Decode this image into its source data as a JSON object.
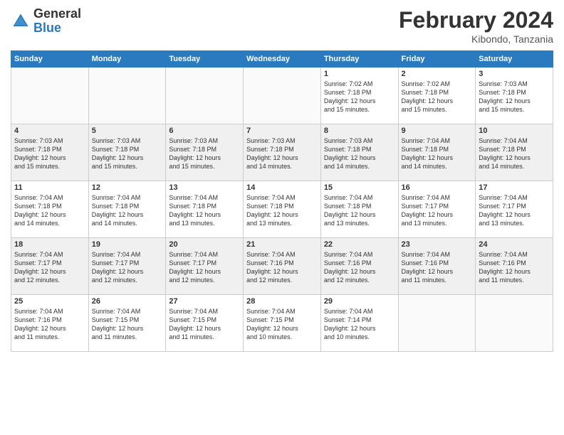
{
  "logo": {
    "general": "General",
    "blue": "Blue"
  },
  "header": {
    "month": "February 2024",
    "location": "Kibondo, Tanzania"
  },
  "weekdays": [
    "Sunday",
    "Monday",
    "Tuesday",
    "Wednesday",
    "Thursday",
    "Friday",
    "Saturday"
  ],
  "weeks": [
    [
      {
        "day": "",
        "info": ""
      },
      {
        "day": "",
        "info": ""
      },
      {
        "day": "",
        "info": ""
      },
      {
        "day": "",
        "info": ""
      },
      {
        "day": "1",
        "info": "Sunrise: 7:02 AM\nSunset: 7:18 PM\nDaylight: 12 hours\nand 15 minutes."
      },
      {
        "day": "2",
        "info": "Sunrise: 7:02 AM\nSunset: 7:18 PM\nDaylight: 12 hours\nand 15 minutes."
      },
      {
        "day": "3",
        "info": "Sunrise: 7:03 AM\nSunset: 7:18 PM\nDaylight: 12 hours\nand 15 minutes."
      }
    ],
    [
      {
        "day": "4",
        "info": "Sunrise: 7:03 AM\nSunset: 7:18 PM\nDaylight: 12 hours\nand 15 minutes."
      },
      {
        "day": "5",
        "info": "Sunrise: 7:03 AM\nSunset: 7:18 PM\nDaylight: 12 hours\nand 15 minutes."
      },
      {
        "day": "6",
        "info": "Sunrise: 7:03 AM\nSunset: 7:18 PM\nDaylight: 12 hours\nand 15 minutes."
      },
      {
        "day": "7",
        "info": "Sunrise: 7:03 AM\nSunset: 7:18 PM\nDaylight: 12 hours\nand 14 minutes."
      },
      {
        "day": "8",
        "info": "Sunrise: 7:03 AM\nSunset: 7:18 PM\nDaylight: 12 hours\nand 14 minutes."
      },
      {
        "day": "9",
        "info": "Sunrise: 7:04 AM\nSunset: 7:18 PM\nDaylight: 12 hours\nand 14 minutes."
      },
      {
        "day": "10",
        "info": "Sunrise: 7:04 AM\nSunset: 7:18 PM\nDaylight: 12 hours\nand 14 minutes."
      }
    ],
    [
      {
        "day": "11",
        "info": "Sunrise: 7:04 AM\nSunset: 7:18 PM\nDaylight: 12 hours\nand 14 minutes."
      },
      {
        "day": "12",
        "info": "Sunrise: 7:04 AM\nSunset: 7:18 PM\nDaylight: 12 hours\nand 14 minutes."
      },
      {
        "day": "13",
        "info": "Sunrise: 7:04 AM\nSunset: 7:18 PM\nDaylight: 12 hours\nand 13 minutes."
      },
      {
        "day": "14",
        "info": "Sunrise: 7:04 AM\nSunset: 7:18 PM\nDaylight: 12 hours\nand 13 minutes."
      },
      {
        "day": "15",
        "info": "Sunrise: 7:04 AM\nSunset: 7:18 PM\nDaylight: 12 hours\nand 13 minutes."
      },
      {
        "day": "16",
        "info": "Sunrise: 7:04 AM\nSunset: 7:17 PM\nDaylight: 12 hours\nand 13 minutes."
      },
      {
        "day": "17",
        "info": "Sunrise: 7:04 AM\nSunset: 7:17 PM\nDaylight: 12 hours\nand 13 minutes."
      }
    ],
    [
      {
        "day": "18",
        "info": "Sunrise: 7:04 AM\nSunset: 7:17 PM\nDaylight: 12 hours\nand 12 minutes."
      },
      {
        "day": "19",
        "info": "Sunrise: 7:04 AM\nSunset: 7:17 PM\nDaylight: 12 hours\nand 12 minutes."
      },
      {
        "day": "20",
        "info": "Sunrise: 7:04 AM\nSunset: 7:17 PM\nDaylight: 12 hours\nand 12 minutes."
      },
      {
        "day": "21",
        "info": "Sunrise: 7:04 AM\nSunset: 7:16 PM\nDaylight: 12 hours\nand 12 minutes."
      },
      {
        "day": "22",
        "info": "Sunrise: 7:04 AM\nSunset: 7:16 PM\nDaylight: 12 hours\nand 12 minutes."
      },
      {
        "day": "23",
        "info": "Sunrise: 7:04 AM\nSunset: 7:16 PM\nDaylight: 12 hours\nand 11 minutes."
      },
      {
        "day": "24",
        "info": "Sunrise: 7:04 AM\nSunset: 7:16 PM\nDaylight: 12 hours\nand 11 minutes."
      }
    ],
    [
      {
        "day": "25",
        "info": "Sunrise: 7:04 AM\nSunset: 7:16 PM\nDaylight: 12 hours\nand 11 minutes."
      },
      {
        "day": "26",
        "info": "Sunrise: 7:04 AM\nSunset: 7:15 PM\nDaylight: 12 hours\nand 11 minutes."
      },
      {
        "day": "27",
        "info": "Sunrise: 7:04 AM\nSunset: 7:15 PM\nDaylight: 12 hours\nand 11 minutes."
      },
      {
        "day": "28",
        "info": "Sunrise: 7:04 AM\nSunset: 7:15 PM\nDaylight: 12 hours\nand 10 minutes."
      },
      {
        "day": "29",
        "info": "Sunrise: 7:04 AM\nSunset: 7:14 PM\nDaylight: 12 hours\nand 10 minutes."
      },
      {
        "day": "",
        "info": ""
      },
      {
        "day": "",
        "info": ""
      }
    ]
  ]
}
